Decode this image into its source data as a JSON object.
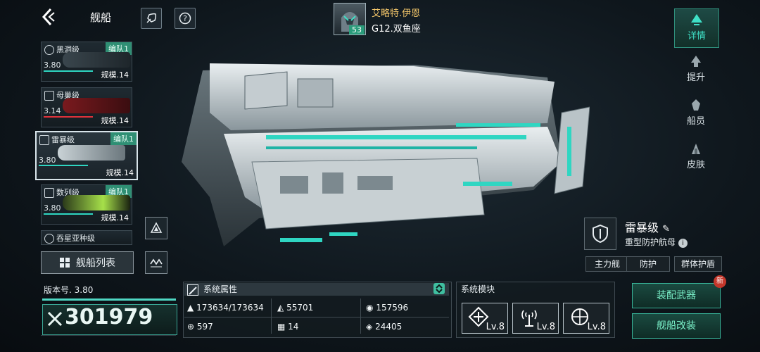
{
  "nav": {
    "title": "舰船"
  },
  "commander": {
    "name": "艾略特.伊恩",
    "level": "53",
    "server": "G12.双鱼座"
  },
  "ship_list": [
    {
      "name": "黑洞级",
      "squad": "编队1",
      "rating": "3.80",
      "scale": "规模.14",
      "type_icon": "close-circle-icon",
      "accent": "#2fd6c2"
    },
    {
      "name": "母巢级",
      "squad": "",
      "rating": "3.14",
      "scale": "规模.14",
      "type_icon": "shield-icon",
      "accent": "#e0323a"
    },
    {
      "name": "雷暴级",
      "squad": "编队1",
      "rating": "3.80",
      "scale": "规模.14",
      "type_icon": "shield-icon",
      "accent": "#2fd6c2",
      "selected": true
    },
    {
      "name": "数列级",
      "squad": "编队1",
      "rating": "3.80",
      "scale": "规模.14",
      "type_icon": "flame-icon",
      "accent": "#a6e04a"
    },
    {
      "name": "吞星亚种级",
      "squad": "",
      "rating": "",
      "scale": "",
      "type_icon": "close-circle-icon",
      "accent": "#2fd6c2"
    }
  ],
  "ship_list_button": "舰船列表",
  "tabs": [
    {
      "label": "详情",
      "icon": "details-icon",
      "active": true
    },
    {
      "label": "提升",
      "icon": "upgrade-icon"
    },
    {
      "label": "船员",
      "icon": "crew-icon"
    },
    {
      "label": "皮肤",
      "icon": "skin-icon"
    }
  ],
  "ship_info": {
    "name": "雷暴级",
    "desc": "重型防护航母",
    "tags": [
      "主力舰",
      "防护",
      "群体护盾"
    ]
  },
  "version": {
    "label": "版本号. 3.80",
    "power": "301979"
  },
  "attributes": {
    "title": "系统属性",
    "rows": [
      [
        "173634/173634",
        "55701",
        "157596"
      ],
      [
        "597",
        "14",
        "24405"
      ]
    ]
  },
  "modules": {
    "title": "系统模块",
    "slots": [
      {
        "icon": "crosshair-diamond-icon",
        "lv": "Lv.8"
      },
      {
        "icon": "antenna-icon",
        "lv": "Lv.8"
      },
      {
        "icon": "target-icon",
        "lv": "Lv.8"
      }
    ]
  },
  "actions": {
    "equip": "装配武器",
    "modify": "舰船改装",
    "new_badge": "新"
  },
  "colors": {
    "accent": "#2fd6c2",
    "gold": "#f2c66a",
    "green_btn": "#38b59a"
  }
}
